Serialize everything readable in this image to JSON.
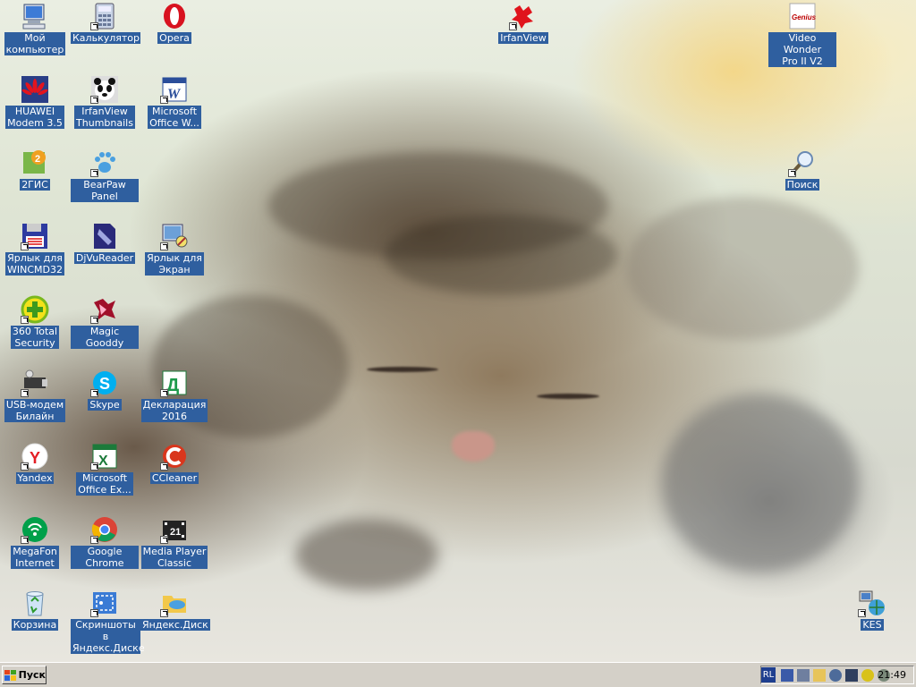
{
  "desktop": {
    "icons": [
      {
        "id": "my-computer",
        "label": "Мой\nкомпьютер",
        "icon": "my-computer-icon",
        "shortcut": false
      },
      {
        "id": "calculator",
        "label": "Калькулятор",
        "icon": "calculator-icon",
        "shortcut": true
      },
      {
        "id": "opera",
        "label": "Opera",
        "icon": "opera-icon",
        "shortcut": false
      },
      {
        "id": "irfanview",
        "label": "IrfanView",
        "icon": "irfanview-icon",
        "shortcut": true
      },
      {
        "id": "video-wonder",
        "label": "Video Wonder\nPro II V2",
        "icon": "genius-icon",
        "shortcut": false
      },
      {
        "id": "huawei-modem",
        "label": "HUAWEI\nModem 3.5",
        "icon": "huawei-icon",
        "shortcut": false
      },
      {
        "id": "irfanview-thumbnails",
        "label": "IrfanView\nThumbnails",
        "icon": "panda-icon",
        "shortcut": true
      },
      {
        "id": "ms-word",
        "label": "Microsoft\nOffice W...",
        "icon": "word-icon",
        "shortcut": true
      },
      {
        "id": "2gis",
        "label": "2ГИС",
        "icon": "2gis-icon",
        "shortcut": false
      },
      {
        "id": "bearpaw",
        "label": "BearPaw Panel",
        "icon": "bearpaw-icon",
        "shortcut": true
      },
      {
        "id": "search",
        "label": "Поиск",
        "icon": "search-icon",
        "shortcut": true
      },
      {
        "id": "wincmd",
        "label": "Ярлык для\nWINCMD32",
        "icon": "floppy-icon",
        "shortcut": true
      },
      {
        "id": "djvureader",
        "label": "DjVuReader",
        "icon": "djvu-icon",
        "shortcut": false
      },
      {
        "id": "screen-shortcut",
        "label": "Ярлык для\nЭкран",
        "icon": "screen-icon",
        "shortcut": true
      },
      {
        "id": "360-security",
        "label": "360 Total\nSecurity",
        "icon": "360-security-icon",
        "shortcut": true
      },
      {
        "id": "magic-gooddy",
        "label": "Magic Gooddy",
        "icon": "magic-gooddy-icon",
        "shortcut": true
      },
      {
        "id": "usb-modem",
        "label": "USB-модем\nБилайн",
        "icon": "usb-modem-icon",
        "shortcut": true
      },
      {
        "id": "skype",
        "label": "Skype",
        "icon": "skype-icon",
        "shortcut": true
      },
      {
        "id": "declaration",
        "label": "Декларация\n2016",
        "icon": "declaration-icon",
        "shortcut": true
      },
      {
        "id": "yandex",
        "label": "Yandex",
        "icon": "yandex-icon",
        "shortcut": true
      },
      {
        "id": "ms-excel",
        "label": "Microsoft\nOffice Ex...",
        "icon": "excel-icon",
        "shortcut": true
      },
      {
        "id": "ccleaner",
        "label": "CCleaner",
        "icon": "ccleaner-icon",
        "shortcut": true
      },
      {
        "id": "megafon",
        "label": "MegaFon\nInternet",
        "icon": "megafon-icon",
        "shortcut": true
      },
      {
        "id": "chrome",
        "label": "Google Chrome",
        "icon": "chrome-icon",
        "shortcut": true
      },
      {
        "id": "mpc",
        "label": "Media Player\nClassic",
        "icon": "media-player-icon",
        "shortcut": true
      },
      {
        "id": "recycle-bin",
        "label": "Корзина",
        "icon": "recycle-bin-icon",
        "shortcut": false
      },
      {
        "id": "yandex-screenshots",
        "label": "Скриншоты в\nЯндекс.Диске",
        "icon": "screenshot-icon",
        "shortcut": true
      },
      {
        "id": "yandex-disk",
        "label": "Яндекс.Диск",
        "icon": "yandex-disk-icon",
        "shortcut": true
      },
      {
        "id": "kes",
        "label": "KES",
        "icon": "network-icon",
        "shortcut": true
      }
    ]
  },
  "taskbar": {
    "start_label": "Пуск",
    "language": "RL",
    "clock": "21:49",
    "tray_icons": [
      "network-tray-icon",
      "monitor-tray-icon",
      "folder-tray-icon",
      "antivirus-tray-icon",
      "speaker-tray-icon",
      "safety-tray-icon",
      "sync-tray-icon"
    ]
  }
}
